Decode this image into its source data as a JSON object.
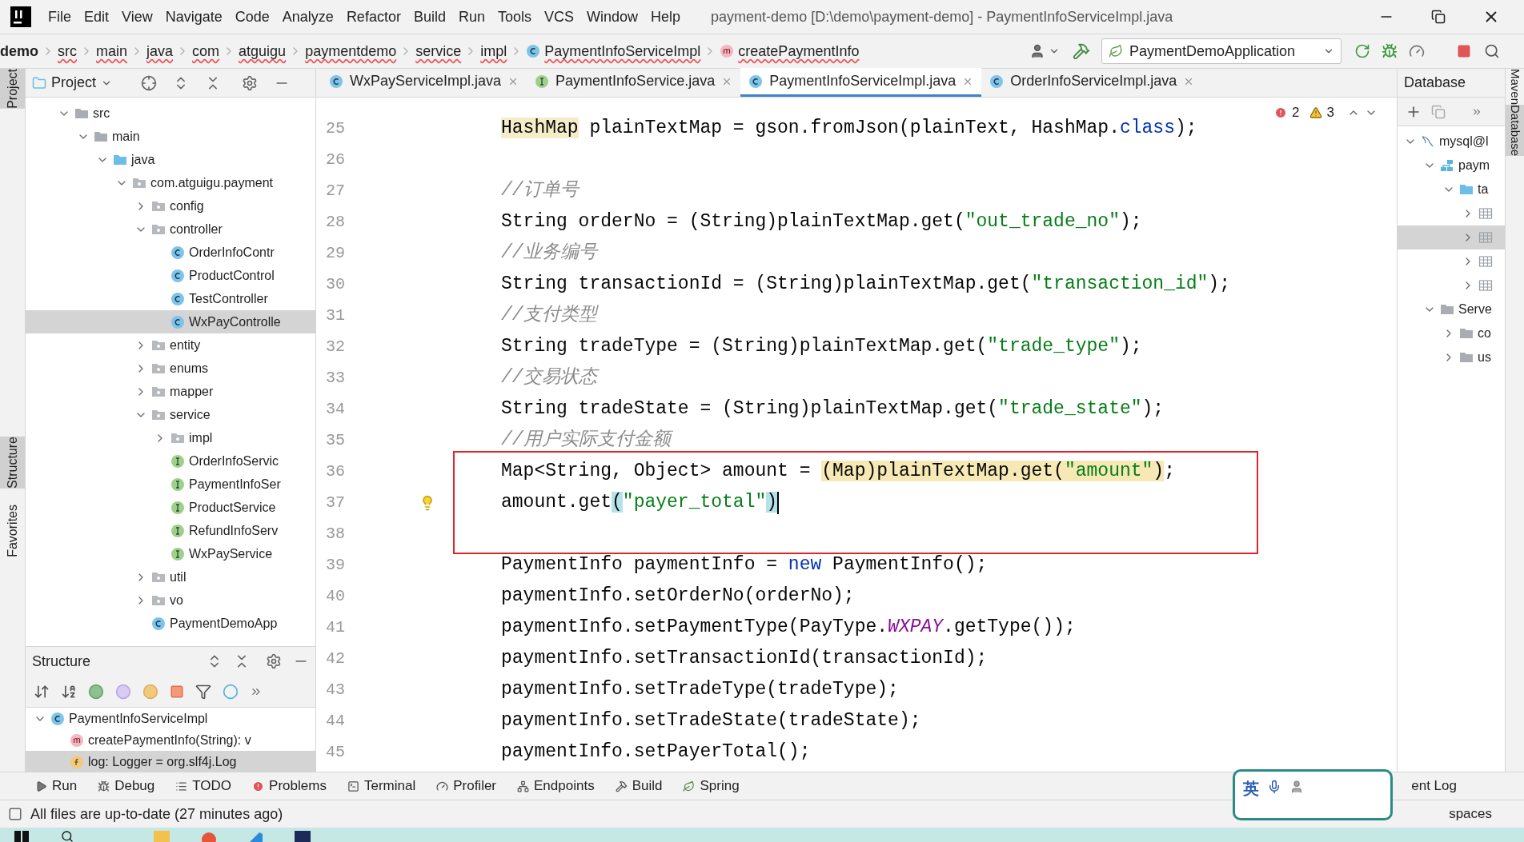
{
  "title_bar": {
    "menus": [
      "File",
      "Edit",
      "View",
      "Navigate",
      "Code",
      "Analyze",
      "Refactor",
      "Build",
      "Run",
      "Tools",
      "VCS",
      "Window",
      "Help"
    ],
    "title": "payment-demo [D:\\demo\\payment-demo] - PaymentInfoServiceImpl.java"
  },
  "navigation_bar": {
    "crumbs": [
      {
        "label": "demo"
      },
      {
        "label": "src"
      },
      {
        "label": "main"
      },
      {
        "label": "java"
      },
      {
        "label": "com"
      },
      {
        "label": "atguigu"
      },
      {
        "label": "paymentdemo"
      },
      {
        "label": "service"
      },
      {
        "label": "impl"
      },
      {
        "label": "PaymentInfoServiceImpl",
        "kind": "class"
      },
      {
        "label": "createPaymentInfo",
        "kind": "method"
      }
    ],
    "run_config": "PaymentDemoApplication"
  },
  "left_stripe": [
    {
      "label": "Project",
      "selected": true
    },
    {
      "label": "Structure",
      "selected": true
    },
    {
      "label": "Favorites",
      "selected": false
    }
  ],
  "project_panel": {
    "title": "Project",
    "tree": [
      {
        "label": "src",
        "kind": "folder",
        "expanded": true,
        "selected": false,
        "children": [
          {
            "label": "main",
            "kind": "folder",
            "expanded": true,
            "selected": false,
            "children": [
              {
                "label": "java",
                "kind": "source-folder",
                "expanded": true,
                "selected": false,
                "children": [
                  {
                    "label": "com.atguigu.payment",
                    "kind": "package",
                    "expanded": true,
                    "selected": false,
                    "children": [
                      {
                        "label": "config",
                        "kind": "package",
                        "expanded": false,
                        "selected": false
                      },
                      {
                        "label": "controller",
                        "kind": "package",
                        "expanded": true,
                        "selected": false,
                        "children": [
                          {
                            "label": "OrderInfoContr",
                            "kind": "class",
                            "selected": false
                          },
                          {
                            "label": "ProductControl",
                            "kind": "class",
                            "selected": false
                          },
                          {
                            "label": "TestController",
                            "kind": "class",
                            "selected": false
                          },
                          {
                            "label": "WxPayControlle",
                            "kind": "class",
                            "selected": true
                          }
                        ]
                      },
                      {
                        "label": "entity",
                        "kind": "package",
                        "expanded": false,
                        "selected": false
                      },
                      {
                        "label": "enums",
                        "kind": "package",
                        "expanded": false,
                        "selected": false
                      },
                      {
                        "label": "mapper",
                        "kind": "package",
                        "expanded": false,
                        "selected": false
                      },
                      {
                        "label": "service",
                        "kind": "package",
                        "expanded": true,
                        "selected": false,
                        "children": [
                          {
                            "label": "impl",
                            "kind": "package",
                            "expanded": false,
                            "selected": false
                          },
                          {
                            "label": "OrderInfoServic",
                            "kind": "interface",
                            "selected": false
                          },
                          {
                            "label": "PaymentInfoSer",
                            "kind": "interface",
                            "selected": false
                          },
                          {
                            "label": "ProductService",
                            "kind": "interface",
                            "selected": false
                          },
                          {
                            "label": "RefundInfoServ",
                            "kind": "interface",
                            "selected": false
                          },
                          {
                            "label": "WxPayService",
                            "kind": "interface",
                            "selected": false
                          }
                        ]
                      },
                      {
                        "label": "util",
                        "kind": "package",
                        "expanded": false,
                        "selected": false
                      },
                      {
                        "label": "vo",
                        "kind": "package",
                        "expanded": false,
                        "selected": false
                      },
                      {
                        "label": "PaymentDemoApp",
                        "kind": "class",
                        "selected": false
                      }
                    ]
                  }
                ]
              }
            ]
          }
        ]
      }
    ]
  },
  "structure_panel": {
    "title": "Structure",
    "tree": [
      {
        "label": "PaymentInfoServiceImpl",
        "kind": "class",
        "expanded": true,
        "selected": false,
        "children": [
          {
            "label": "createPaymentInfo(String): v",
            "kind": "method",
            "selected": false
          },
          {
            "label": "log: Logger = org.slf4j.Log",
            "kind": "field",
            "selected": true
          }
        ]
      }
    ]
  },
  "editor": {
    "tabs": [
      {
        "label": "WxPayServiceImpl.java",
        "kind": "class",
        "selected": false
      },
      {
        "label": "PaymentInfoService.java",
        "kind": "interface",
        "selected": false
      },
      {
        "label": "PaymentInfoServiceImpl.java",
        "kind": "class",
        "selected": true
      },
      {
        "label": "OrderInfoServiceImpl.java",
        "kind": "class",
        "selected": false
      }
    ],
    "inspections": {
      "errors": "2",
      "warnings": "3"
    },
    "lines": [
      {
        "number": "25",
        "boxed": false,
        "bulb": false,
        "caret": false,
        "segments": [
          {
            "text": "HashMap",
            "kind": "type-highlight"
          },
          {
            "text": " plainTextMap = gson.fromJson(plainText, HashMap.",
            "kind": "plain"
          },
          {
            "text": "class",
            "kind": "keyword"
          },
          {
            "text": ");",
            "kind": "plain"
          }
        ]
      },
      {
        "number": "26",
        "boxed": false,
        "bulb": false,
        "caret": false
      },
      {
        "number": "27",
        "boxed": false,
        "bulb": false,
        "caret": false,
        "segments": [
          {
            "text": "//订单号",
            "kind": "comment"
          }
        ]
      },
      {
        "number": "28",
        "boxed": false,
        "bulb": false,
        "caret": false,
        "segments": [
          {
            "text": "String orderNo = (String)plainTextMap.get(",
            "kind": "plain"
          },
          {
            "text": "\"out_trade_no\"",
            "kind": "string"
          },
          {
            "text": ");",
            "kind": "plain"
          }
        ]
      },
      {
        "number": "29",
        "boxed": false,
        "bulb": false,
        "caret": false,
        "segments": [
          {
            "text": "//业务编号",
            "kind": "comment"
          }
        ]
      },
      {
        "number": "30",
        "boxed": false,
        "bulb": false,
        "caret": false,
        "segments": [
          {
            "text": "String transactionId = (String)plainTextMap.get(",
            "kind": "plain"
          },
          {
            "text": "\"transaction_id\"",
            "kind": "string"
          },
          {
            "text": ");",
            "kind": "plain"
          }
        ]
      },
      {
        "number": "31",
        "boxed": false,
        "bulb": false,
        "caret": false,
        "segments": [
          {
            "text": "//支付类型",
            "kind": "comment"
          }
        ]
      },
      {
        "number": "32",
        "boxed": false,
        "bulb": false,
        "caret": false,
        "segments": [
          {
            "text": "String tradeType = (String)plainTextMap.get(",
            "kind": "plain"
          },
          {
            "text": "\"trade_type\"",
            "kind": "string"
          },
          {
            "text": ");",
            "kind": "plain"
          }
        ]
      },
      {
        "number": "33",
        "boxed": false,
        "bulb": false,
        "caret": false,
        "segments": [
          {
            "text": "//交易状态",
            "kind": "comment"
          }
        ]
      },
      {
        "number": "34",
        "boxed": false,
        "bulb": false,
        "caret": false,
        "segments": [
          {
            "text": "String tradeState = (String)plainTextMap.get(",
            "kind": "plain"
          },
          {
            "text": "\"trade_state\"",
            "kind": "string"
          },
          {
            "text": ");",
            "kind": "plain"
          }
        ]
      },
      {
        "number": "35",
        "boxed": false,
        "bulb": false,
        "caret": false,
        "segments": [
          {
            "text": "//用户实际支付金额",
            "kind": "comment"
          }
        ]
      },
      {
        "number": "36",
        "boxed": true,
        "bulb": false,
        "caret": false,
        "segments": [
          {
            "text": "Map<String, Object> amount = ",
            "kind": "plain"
          },
          {
            "text": "(Map)plainTextMap.get(",
            "kind": "warning-highlight"
          },
          {
            "text": "\"amount\"",
            "kind": "string-warning"
          },
          {
            "text": ")",
            "kind": "warning-highlight"
          },
          {
            "text": ";",
            "kind": "plain"
          }
        ]
      },
      {
        "number": "37",
        "boxed": true,
        "bulb": true,
        "caret": true,
        "segments": [
          {
            "text": "amount.get",
            "kind": "plain"
          },
          {
            "text": "(",
            "kind": "brace-match"
          },
          {
            "text": "\"payer_total\"",
            "kind": "string"
          },
          {
            "text": ")",
            "kind": "brace-match"
          }
        ]
      },
      {
        "number": "38",
        "boxed": true,
        "bulb": false,
        "caret": false
      },
      {
        "number": "39",
        "boxed": false,
        "bulb": false,
        "caret": false,
        "segments": [
          {
            "text": "PaymentInfo paymentInfo = ",
            "kind": "plain"
          },
          {
            "text": "new",
            "kind": "keyword"
          },
          {
            "text": " PaymentInfo();",
            "kind": "plain"
          }
        ]
      },
      {
        "number": "40",
        "boxed": false,
        "bulb": false,
        "caret": false,
        "segments": [
          {
            "text": "paymentInfo.setOrderNo(orderNo);",
            "kind": "plain"
          }
        ]
      },
      {
        "number": "41",
        "boxed": false,
        "bulb": false,
        "caret": false,
        "segments": [
          {
            "text": "paymentInfo.setPaymentType(PayType.",
            "kind": "plain"
          },
          {
            "text": "WXPAY",
            "kind": "constant"
          },
          {
            "text": ".getType());",
            "kind": "plain"
          }
        ]
      },
      {
        "number": "42",
        "boxed": false,
        "bulb": false,
        "caret": false,
        "segments": [
          {
            "text": "paymentInfo.setTransactionId(transactionId);",
            "kind": "plain"
          }
        ]
      },
      {
        "number": "43",
        "boxed": false,
        "bulb": false,
        "caret": false,
        "segments": [
          {
            "text": "paymentInfo.setTradeType(tradeType);",
            "kind": "plain"
          }
        ]
      },
      {
        "number": "44",
        "boxed": false,
        "bulb": false,
        "caret": false,
        "segments": [
          {
            "text": "paymentInfo.setTradeState(tradeState);",
            "kind": "plain"
          }
        ]
      },
      {
        "number": "45",
        "boxed": false,
        "bulb": false,
        "caret": false,
        "segments": [
          {
            "text": "paymentInfo.setPayerTotal();",
            "kind": "plain"
          }
        ]
      }
    ]
  },
  "database_panel": {
    "title": "Database",
    "tree": [
      {
        "label": "mysql@l",
        "kind": "mysql",
        "expanded": true,
        "selected": false,
        "children": [
          {
            "label": "paym",
            "kind": "schema",
            "expanded": true,
            "selected": false,
            "children": [
              {
                "label": "ta",
                "kind": "source-folder",
                "expanded": true,
                "selected": false,
                "children": [
                  {
                    "kind": "table",
                    "expanded": false,
                    "selected": false
                  },
                  {
                    "kind": "table",
                    "expanded": false,
                    "selected": true
                  },
                  {
                    "kind": "table",
                    "expanded": false,
                    "selected": false
                  },
                  {
                    "kind": "table",
                    "expanded": false,
                    "selected": false
                  }
                ]
              }
            ]
          },
          {
            "label": "Serve",
            "kind": "folder",
            "expanded": true,
            "selected": false,
            "children": [
              {
                "label": "co",
                "kind": "folder",
                "expanded": false,
                "selected": false
              },
              {
                "label": "us",
                "kind": "folder",
                "expanded": false,
                "selected": false
              }
            ]
          }
        ]
      }
    ]
  },
  "right_stripe": [
    {
      "label": "Maven",
      "selected": false
    },
    {
      "label": "Database",
      "selected": true
    }
  ],
  "tool_window_bar": {
    "items": [
      {
        "label": "Run",
        "kind": "run"
      },
      {
        "label": "Debug",
        "kind": "debug"
      },
      {
        "label": "TODO",
        "kind": "todo"
      },
      {
        "label": "Problems",
        "kind": "problems"
      },
      {
        "label": "Terminal",
        "kind": "terminal"
      },
      {
        "label": "Profiler",
        "kind": "profiler"
      },
      {
        "label": "Endpoints",
        "kind": "endpoints"
      },
      {
        "label": "Build",
        "kind": "build"
      },
      {
        "label": "Spring",
        "kind": "spring"
      }
    ],
    "right": "ent Log"
  },
  "ime_widget": {
    "label": "英"
  },
  "status_bar": {
    "message": "All files are up-to-date (27 minutes ago)",
    "right": "spaces"
  }
}
